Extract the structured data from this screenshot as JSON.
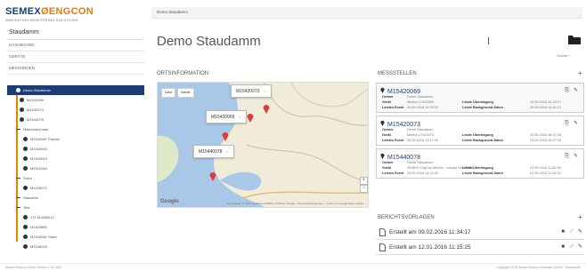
{
  "brand": {
    "semex": "SEMEX",
    "separator": "Ø",
    "engcon": "ENGCON",
    "tagline": "INNOVATION MONITORING SOLUTIONS"
  },
  "sidebar": {
    "title": "Staudamm",
    "links": [
      "DASHBOARD",
      "GERÄTE",
      "MESSUNGEN"
    ],
    "tree": [
      {
        "label": "Demo Staudamm",
        "selected": true,
        "indent": 10
      },
      {
        "label": "M1542069",
        "indent": 14
      },
      {
        "label": "M1542073",
        "indent": 14
      },
      {
        "label": "M1544078",
        "indent": 14
      },
      {
        "label": "Maschinenhaus",
        "indent": 10,
        "group": true
      },
      {
        "label": "M1544087 Pranter",
        "indent": 18
      },
      {
        "label": "M1544093",
        "indent": 18
      },
      {
        "label": "M1543013",
        "indent": 18
      },
      {
        "label": "M1542054",
        "indent": 18
      },
      {
        "label": "Zelen",
        "indent": 10,
        "group": true
      },
      {
        "label": "M1233072",
        "indent": 18
      },
      {
        "label": "Staudenk",
        "indent": 10,
        "group": true
      },
      {
        "label": "Test",
        "indent": 10,
        "group": true
      },
      {
        "label": "171 M1689012",
        "indent": 18
      },
      {
        "label": "M1163895",
        "indent": 18
      },
      {
        "label": "M1544082 Sätra",
        "indent": 18
      },
      {
        "label": "M1546029",
        "indent": 18
      }
    ]
  },
  "breadcrumb": "Demo Staudamm",
  "page_title": "Demo Staudamm",
  "folder_label": "Ordner +",
  "map": {
    "heading": "ORTSINFORMATION",
    "map_type_buttons": [
      "Karte",
      "Satellit"
    ],
    "markers": [
      {
        "label": "M15420073",
        "close": "×"
      },
      {
        "label": "M15420069",
        "close": "×"
      },
      {
        "label": "M15440078",
        "close": "×"
      }
    ],
    "zoom_in": "+",
    "zoom_out": "−",
    "google": "Google",
    "attribution": "Kartendaten © 2016 GeoBasis-DE/BKG (©2009), Google · Nutzungsbedingungen · Fehler bei Google Maps melden"
  },
  "messstellen": {
    "heading": "MESSSTELLEN",
    "add": "+",
    "items": [
      {
        "id": "M15420069",
        "rows": [
          {
            "label": "Ordner",
            "value": "Demo Staudamm",
            "label2": "",
            "value2": ""
          },
          {
            "label": "Gerät",
            "value": "Mentor-LT420069",
            "label2": "Letzte Übertragung",
            "value2": "25.05.2016 16:16:27"
          },
          {
            "label": "Letztes Event",
            "value": "25.05.2016 14:09:40",
            "label2": "Letzte Background-Daten",
            "value2": "25.05.2016 16:16:12"
          }
        ]
      },
      {
        "id": "M15420073",
        "rows": [
          {
            "label": "Ordner",
            "value": "Demo Staudamm",
            "label2": "",
            "value2": ""
          },
          {
            "label": "Gerät",
            "value": "Mentor-LT420073",
            "label2": "Letzte Übertragung",
            "value2": "24.05.2016 16:20:06"
          },
          {
            "label": "Letztes Event",
            "value": "26.05.2016 13:47:16",
            "label2": "Letzte Background-Daten",
            "value2": "24.05.2016 16:07:16"
          }
        ]
      },
      {
        "id": "M15440078",
        "rows": [
          {
            "label": "Ordner",
            "value": "Demo Staudamm",
            "label2": "",
            "value2": ""
          },
          {
            "label": "Gerät",
            "value": "SEMEX EngCon Mentor - mentor 15440078",
            "label2": "Letzte Übertragung",
            "value2": "24.05.2016 11:32:36"
          },
          {
            "label": "Letztes Event",
            "value": "24.05.2016 14:14:50",
            "label2": "Letzte Background-Daten",
            "value2": "24.05.2016 11:32:03"
          }
        ]
      }
    ]
  },
  "berichte": {
    "heading": "BERICHTSVORLAGEN",
    "add": "+",
    "items": [
      {
        "label": "Erstellt am 09.02.2016 11:34:17"
      },
      {
        "label": "Erstellt am 12.01.2016 11:15:25"
      }
    ]
  },
  "footer": {
    "left": "Semex Engcon Cloud Version 1.16.1002",
    "right": "Copyright 2016 Semex Engcon Software GmbH · Impressum"
  },
  "colors": {
    "navy": "#1b3d75",
    "orange": "#e07a10",
    "pin_red": "#e03a3a"
  }
}
